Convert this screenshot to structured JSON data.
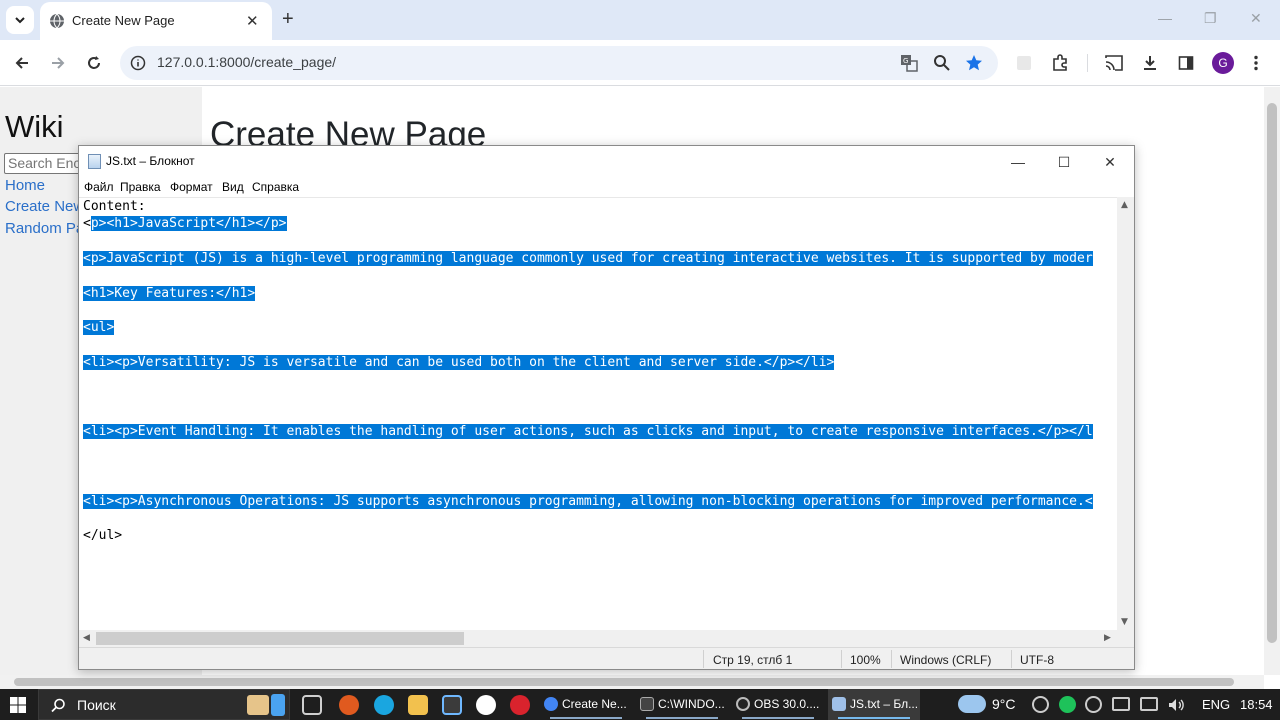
{
  "browser": {
    "tab_title": "Create New Page",
    "url": "127.0.0.1:8000/create_page/",
    "profile_initial": "G"
  },
  "page": {
    "site_title": "Wiki",
    "search_placeholder": "Search Encyclopedia",
    "nav": [
      "Home",
      "Create New Page",
      "Random Page"
    ],
    "heading": "Create New Page",
    "content_label": "Content:"
  },
  "notepad": {
    "title": "JS.txt – Блокнот",
    "menu": [
      "Файл",
      "Правка",
      "Формат",
      "Вид",
      "Справка"
    ],
    "lines": [
      {
        "pre": "<",
        "sel": "p><h1>JavaScript</h1></p>"
      },
      {
        "pre": "",
        "sel": "<p>JavaScript (JS) is a high-level programming language commonly used for creating interactive websites. It is supported by moder"
      },
      {
        "pre": "",
        "sel": "<h1>Key Features:</h1>"
      },
      {
        "pre": "",
        "sel": "<ul>"
      },
      {
        "pre": "",
        "sel": "<li><p>Versatility: JS is versatile and can be used both on the client and server side.</p></li>"
      },
      {
        "pre": "",
        "sel": "<li><p>Event Handling: It enables the handling of user actions, such as clicks and input, to create responsive interfaces.</p></l"
      },
      {
        "pre": "",
        "sel": "<li><p>Asynchronous Operations: JS supports asynchronous programming, allowing non-blocking operations for improved performance.<"
      },
      {
        "pre": "</ul>",
        "sel": ""
      }
    ],
    "status": {
      "position": "Стр 19, стлб 1",
      "zoom": "100%",
      "line_ending": "Windows (CRLF)",
      "encoding": "UTF-8"
    }
  },
  "taskbar": {
    "search_label": "Поиск",
    "windows": [
      {
        "label": "Create Ne...",
        "color": "#4285f4"
      },
      {
        "label": "C:\\WINDO...",
        "color": "#444444"
      },
      {
        "label": "OBS 30.0....",
        "color": "#888888"
      },
      {
        "label": "JS.txt – Бл...",
        "color": "#9fc0e8"
      }
    ],
    "temperature": "9°C",
    "language": "ENG",
    "time": "18:54"
  }
}
